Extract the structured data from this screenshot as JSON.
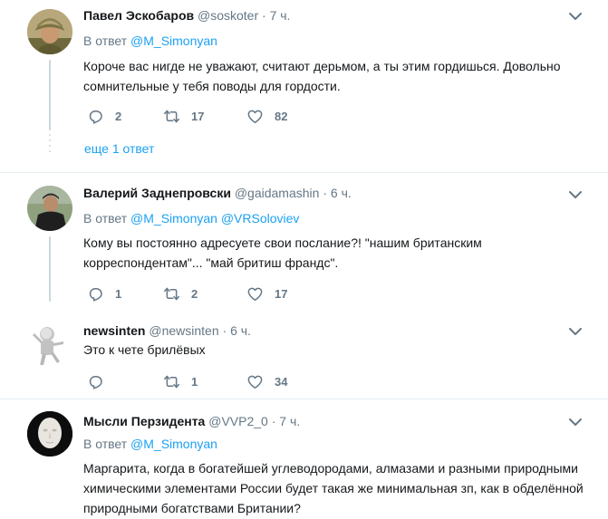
{
  "tweets": [
    {
      "name": "Павел Эскобаров",
      "handle": "@soskoter",
      "time": "7 ч.",
      "reply_prefix": "В ответ",
      "reply_to": [
        "@M_Simonyan"
      ],
      "text": "Короче вас нигде не уважают, считают дерьмом, а ты этим гордишься. Довольно сомнительные у тебя поводы для гордости.",
      "replies": "2",
      "retweets": "17",
      "likes": "82"
    },
    {
      "name": "Валерий Заднепровски",
      "handle": "@gaidamashin",
      "time": "6 ч.",
      "reply_prefix": "В ответ",
      "reply_to": [
        "@M_Simonyan",
        "@VRSoloviev"
      ],
      "text": "Кому вы постоянно адресуете свои послание?! \"нашим британским корреспондентам\"... \"май бритиш франдс\".",
      "replies": "1",
      "retweets": "2",
      "likes": "17"
    },
    {
      "name": "newsinten",
      "handle": "@newsinten",
      "time": "6 ч.",
      "text": "Это к чете брилёвых",
      "replies": "",
      "retweets": "1",
      "likes": "34"
    },
    {
      "name": "Мысли Перзидента",
      "handle": "@VVP2_0",
      "time": "7 ч.",
      "reply_prefix": "В ответ",
      "reply_to": [
        "@M_Simonyan"
      ],
      "text": "Маргарита, когда в богатейшей углеводородами, алмазами и разными природными химическими элементами России будет такая же минимальная зп, как в обделённой природными богатствами Британии?"
    }
  ],
  "more_replies_label": "еще 1 ответ",
  "colors": {
    "accent": "#1da1f2",
    "secondary_text": "#657786",
    "divider": "#e6ecf0",
    "thread_line": "#ccd6dd"
  },
  "icons": {
    "reply": "reply-icon",
    "retweet": "retweet-icon",
    "like": "heart-icon",
    "menu": "chevron-down-icon"
  }
}
